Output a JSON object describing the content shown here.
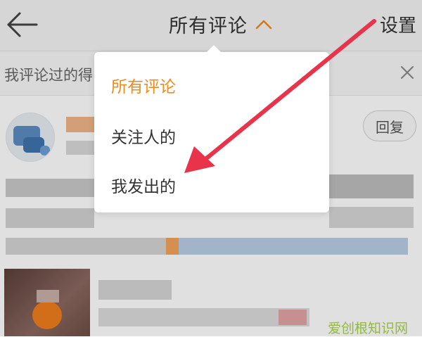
{
  "header": {
    "title": "所有评论",
    "settings_label": "设置"
  },
  "notice": {
    "text": "我评论过的得"
  },
  "dropdown": {
    "items": [
      {
        "label": "所有评论",
        "selected": true
      },
      {
        "label": "关注人的",
        "selected": false
      },
      {
        "label": "我发出的",
        "selected": false
      }
    ]
  },
  "comment": {
    "reply_label": "回复"
  },
  "watermark": "爱创根知识网",
  "colors": {
    "accent": "#f08a1c",
    "arrow": "#e8334a",
    "top_bar_bg": "#f4f4f4"
  },
  "icons": {
    "back": "arrow-left-icon",
    "title_caret": "chevron-up-icon",
    "close": "close-icon"
  }
}
